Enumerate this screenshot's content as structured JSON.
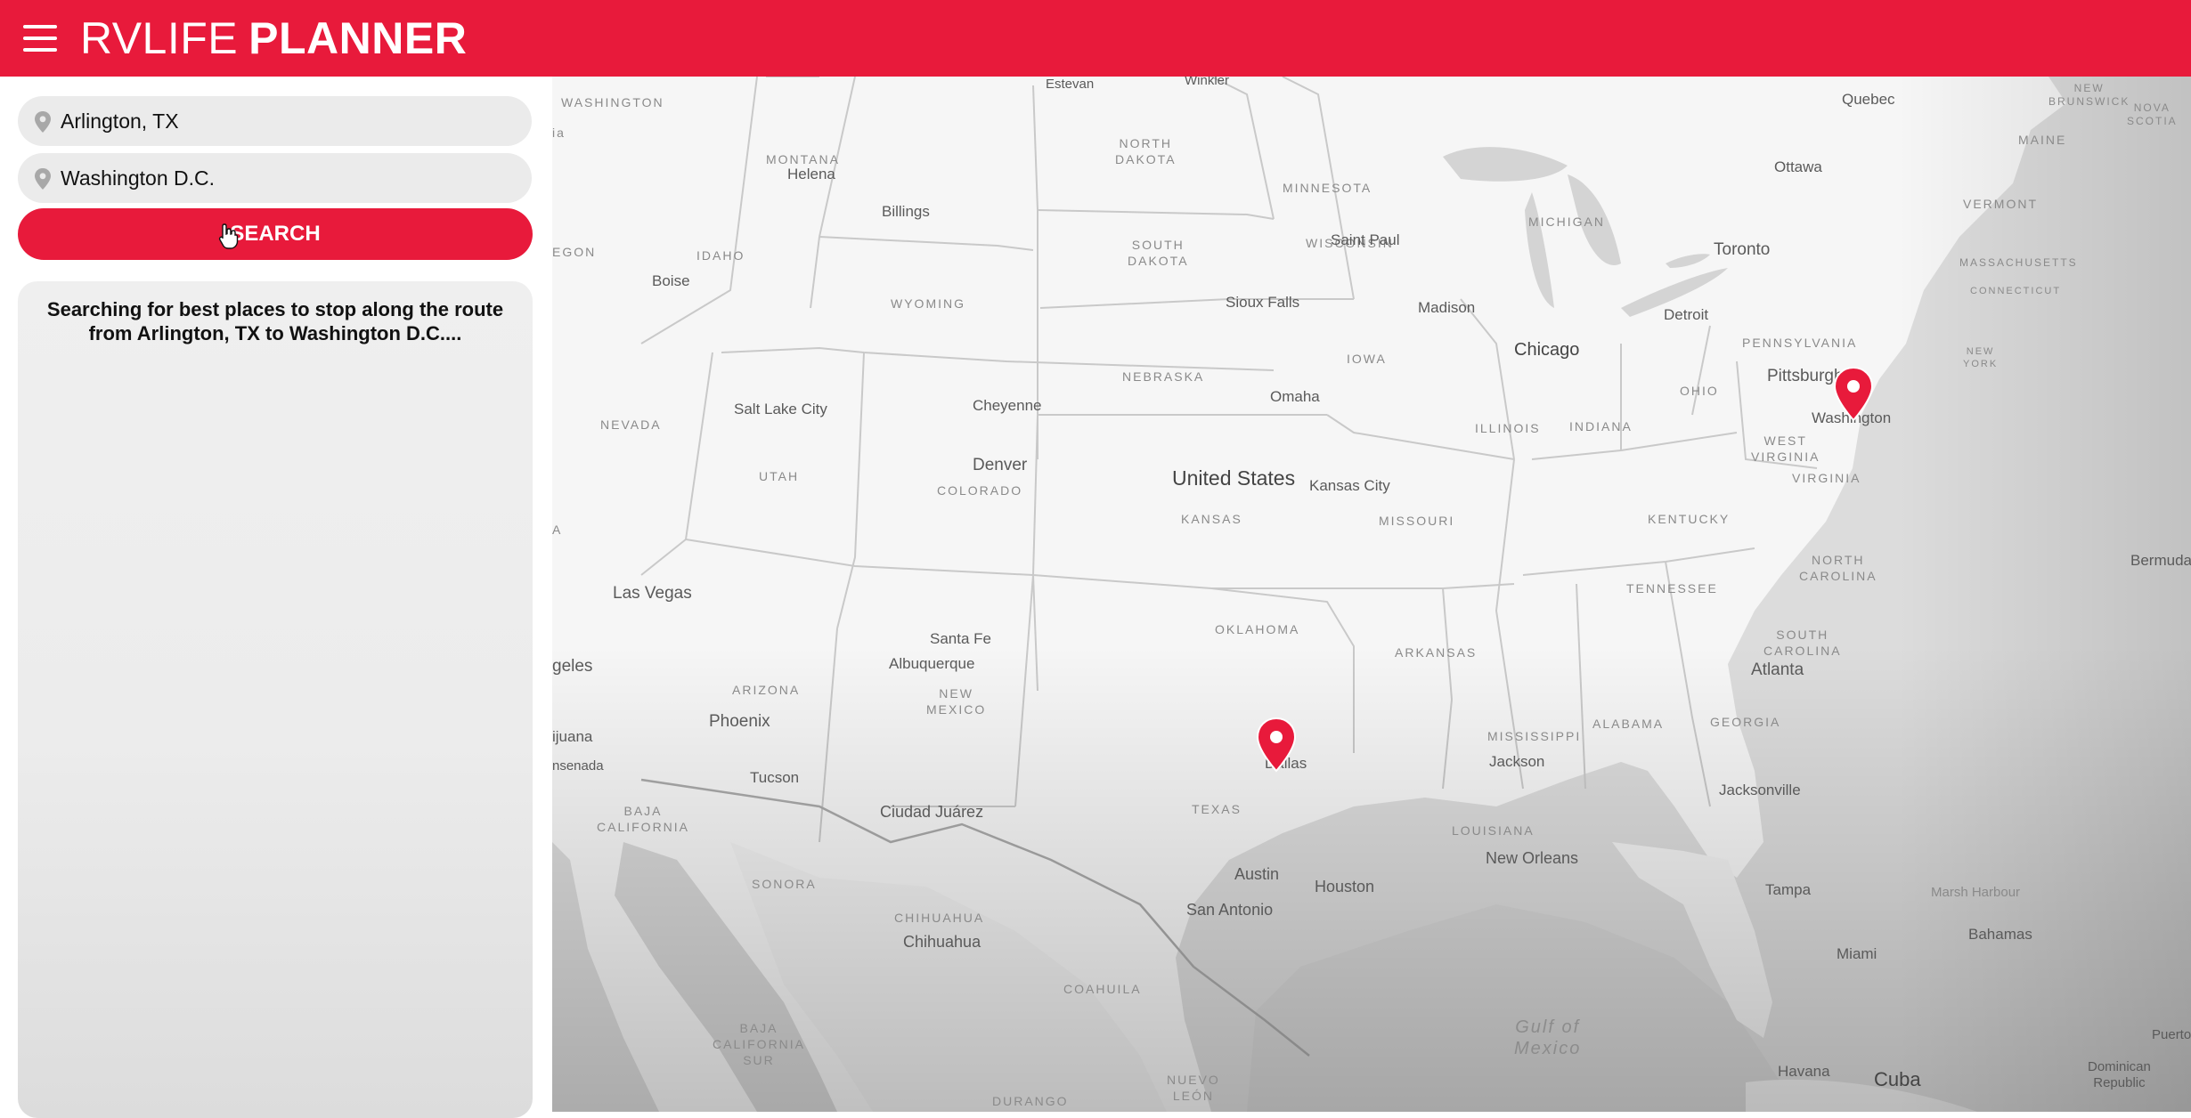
{
  "app": {
    "brand_light": "RVLIFE",
    "brand_bold": "PLANNER",
    "accent": "#e81a3b"
  },
  "header": {
    "menu_icon": "hamburger-menu-icon"
  },
  "form": {
    "origin_value": "Arlington, TX",
    "destination_value": "Washington D.C.",
    "search_label": "SEARCH",
    "pin_icon": "location-pin-icon"
  },
  "status": {
    "message": "Searching for best places to stop along the route from Arlington, TX to Washington D.C...."
  },
  "map": {
    "country_label": "United States",
    "states": {
      "washington": "WASHINGTON",
      "montana": "MONTANA",
      "north_dakota": "NORTH\nDAKOTA",
      "minnesota": "MINNESOTA",
      "oregon": "EGON",
      "idaho": "IDAHO",
      "south_dakota": "SOUTH\nDAKOTA",
      "wisconsin": "WISCONSIN",
      "michigan": "MICHIGAN",
      "wyoming": "WYOMING",
      "nebraska": "NEBRASKA",
      "iowa": "IOWA",
      "nevada": "NEVADA",
      "utah": "UTAH",
      "colorado": "COLORADO",
      "kansas": "KANSAS",
      "missouri": "MISSOURI",
      "illinois": "ILLINOIS",
      "indiana": "INDIANA",
      "ohio": "OHIO",
      "pennsylvania": "PENNSYLVANIA",
      "new_york": "NEW\nYORK",
      "vermont": "VERMONT",
      "maine": "MAINE",
      "new_brunswick": "NEW\nBRUNSWICK",
      "nova_scotia": "NOVA\nSCOTIA",
      "massachusetts": "MASSACHUSETTS",
      "connecticut": "CONNECTICUT",
      "west_virginia": "WEST\nVIRGINIA",
      "virginia": "VIRGINIA",
      "kentucky": "KENTUCKY",
      "tennessee": "TENNESSEE",
      "north_carolina": "NORTH\nCAROLINA",
      "south_carolina": "SOUTH\nCAROLINA",
      "oklahoma": "OKLAHOMA",
      "arkansas": "ARKANSAS",
      "arizona": "ARIZONA",
      "new_mexico": "NEW\nMEXICO",
      "texas": "TEXAS",
      "mississippi": "MISSISSIPPI",
      "alabama": "ALABAMA",
      "georgia": "GEORGIA",
      "louisiana": "LOUISIANA",
      "baja_california": "BAJA\nCALIFORNIA",
      "sonora": "SONORA",
      "chihuahua_state": "CHIHUAHUA",
      "baja_california_sur": "BAJA\nCALIFORNIA\nSUR",
      "coahuila": "COAHUILA",
      "durango": "DURANGO",
      "nuevo_leon": "NUEVO\nLEÓN",
      "ia": "ia",
      "a": "A"
    },
    "cities": {
      "estevan": "Estevan",
      "winkler": "Winkler",
      "quebec": "Quebec",
      "ottawa": "Ottawa",
      "helena": "Helena",
      "billings": "Billings",
      "saint_paul": "Saint Paul",
      "toronto": "Toronto",
      "boise": "Boise",
      "sioux_falls": "Sioux Falls",
      "madison": "Madison",
      "detroit": "Detroit",
      "chicago": "Chicago",
      "pittsburgh": "Pittsburgh",
      "washington": "Washington",
      "salt_lake_city": "Salt Lake City",
      "cheyenne": "Cheyenne",
      "omaha": "Omaha",
      "denver": "Denver",
      "kansas_city": "Kansas City",
      "bermuda": "Bermuda",
      "las_vegas": "Las Vegas",
      "santa_fe": "Santa Fe",
      "albuquerque": "Albuquerque",
      "los_angeles": "geles",
      "atlanta": "Atlanta",
      "tijuana": "ijuana",
      "ensenada": "nsenada",
      "phoenix": "Phoenix",
      "dallas": "Dallas",
      "jackson": "Jackson",
      "tucson": "Tucson",
      "jacksonville": "Jacksonville",
      "ciudad_juarez": "Ciudad Juárez",
      "new_orleans": "New Orleans",
      "austin": "Austin",
      "houston": "Houston",
      "tampa": "Tampa",
      "marsh_harbour": "Marsh Harbour",
      "san_antonio": "San Antonio",
      "chihuahua": "Chihuahua",
      "bahamas": "Bahamas",
      "miami": "Miami",
      "havana": "Havana",
      "cuba": "Cuba",
      "puerto": "Puerto",
      "dominican_republic": "Dominican\nRepublic"
    },
    "water": {
      "gulf": "Gulf of\nMexico"
    },
    "marker_icon": "map-marker-icon"
  }
}
